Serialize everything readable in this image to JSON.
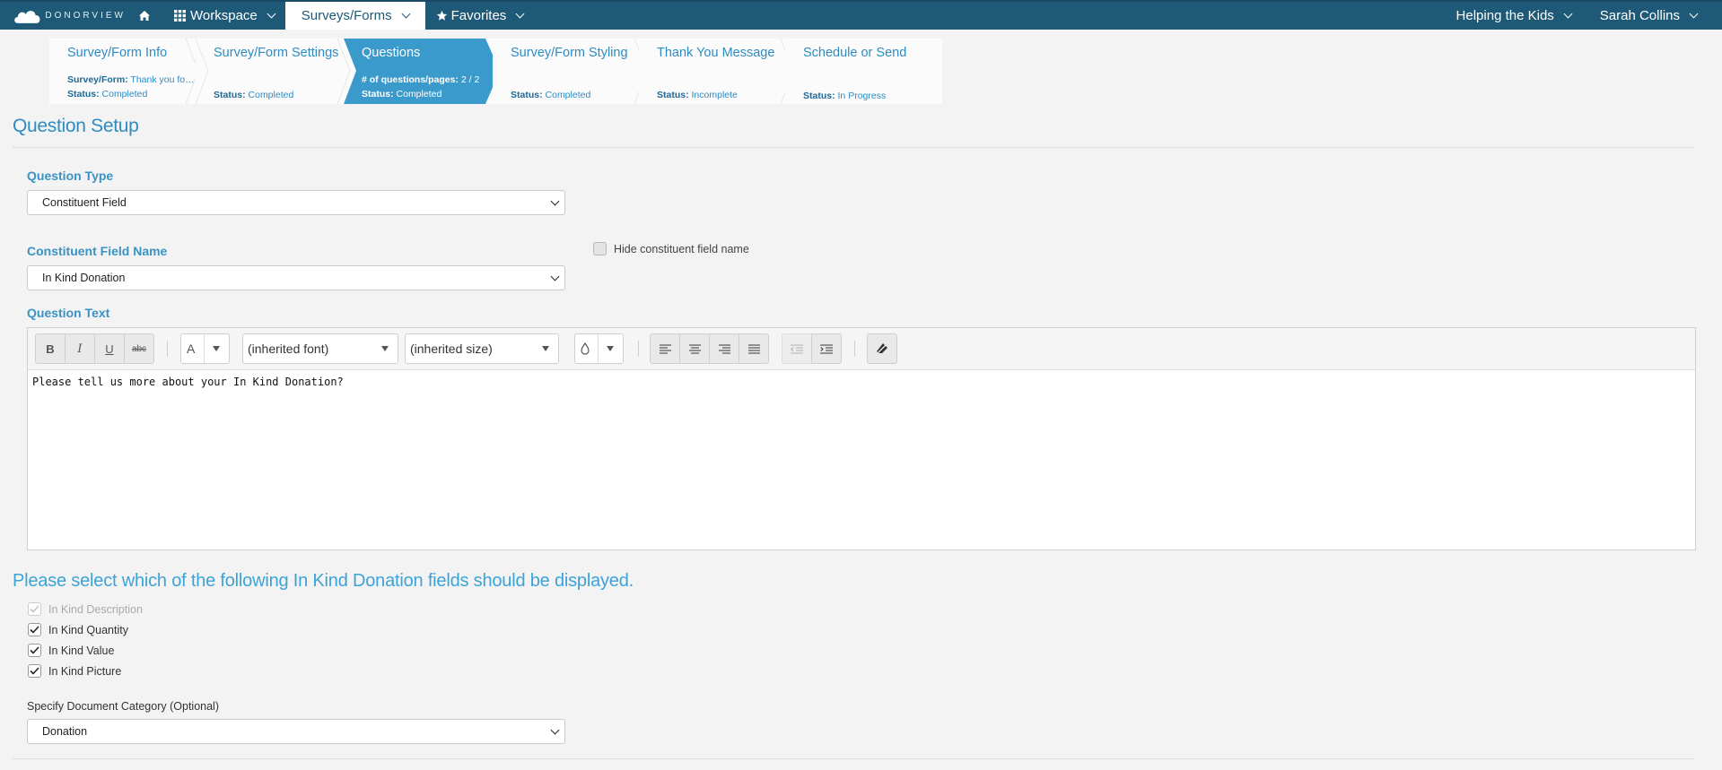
{
  "nav": {
    "brand": "DONORVIEW",
    "workspace": "Workspace",
    "surveys": "Surveys/Forms",
    "favorites": "Favorites",
    "org": "Helping the Kids",
    "user": "Sarah Collins"
  },
  "steps": [
    {
      "name": "Survey/Form Info",
      "line1_label": "Survey/Form:",
      "line1_value": "Thank you for ...",
      "status_label": "Status:",
      "status": "Completed"
    },
    {
      "name": "Survey/Form Settings",
      "status_label": "Status:",
      "status": "Completed"
    },
    {
      "name": "Questions",
      "line1_label": "# of questions/pages:",
      "line1_value": "2 / 2",
      "status_label": "Status:",
      "status": "Completed"
    },
    {
      "name": "Survey/Form Styling",
      "status_label": "Status:",
      "status": "Completed"
    },
    {
      "name": "Thank You Message",
      "status_label": "Status:",
      "status": "Incomplete"
    },
    {
      "name": "Schedule or Send",
      "status_label": "Status:",
      "status": "In Progress"
    }
  ],
  "page_title": "Question Setup",
  "question_type": {
    "label": "Question Type",
    "value": "Constituent Field"
  },
  "constituent_field": {
    "label": "Constituent Field Name",
    "value": "In Kind Donation"
  },
  "hide_field_name": {
    "label": "Hide constituent field name",
    "checked": false
  },
  "question_text": {
    "label": "Question Text",
    "font": "(inherited font)",
    "size": "(inherited size)",
    "body": "Please tell us more about your In Kind Donation?"
  },
  "toolbar": {
    "bold": "B",
    "italic": "I",
    "underline": "U",
    "strike": "abc",
    "font_color": "A"
  },
  "fields_heading": "Please select which of the following In Kind Donation fields should be displayed.",
  "fields": [
    {
      "label": "In Kind Description",
      "checked": true,
      "disabled": true
    },
    {
      "label": "In Kind Quantity",
      "checked": true,
      "disabled": false
    },
    {
      "label": "In Kind Value",
      "checked": true,
      "disabled": false
    },
    {
      "label": "In Kind Picture",
      "checked": true,
      "disabled": false
    }
  ],
  "document_category": {
    "label": "Specify Document Category (Optional)",
    "value": "Donation"
  },
  "colors": {
    "nav": "#1e5a78",
    "accent": "#2e8cc2",
    "active_step": "#3a9acb"
  }
}
